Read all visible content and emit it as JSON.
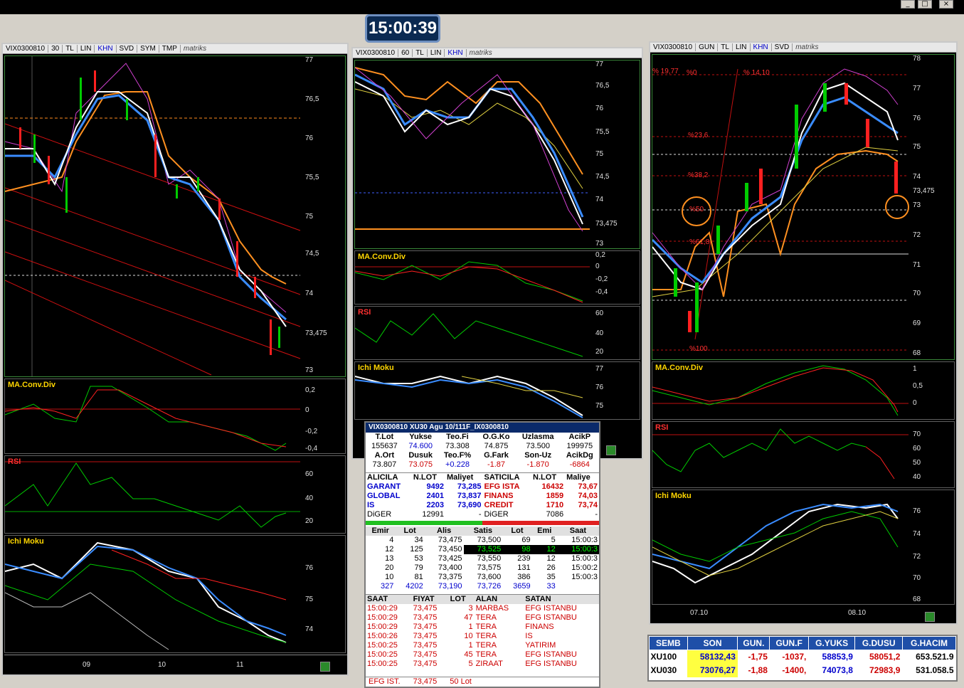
{
  "clock": "15:00:39",
  "window_controls": [
    "_",
    "□",
    "×"
  ],
  "panels": {
    "left": {
      "symbol": "VIX0300810",
      "period": "30",
      "tabs": [
        "TL",
        "LIN",
        "KHN",
        "SVD",
        "SYM",
        "TMP"
      ],
      "brand": "matriks",
      "price_ticks": [
        "77",
        "76,5",
        "76",
        "75,5",
        "75",
        "74,5",
        "74",
        "73,475",
        "73"
      ],
      "sub_labels": [
        "MA.Conv.Div",
        "RSI",
        "Ichi Moku"
      ],
      "macd_ticks": [
        "0,2",
        "0",
        "-0,2",
        "-0,4"
      ],
      "rsi_ticks": [
        "60",
        "40",
        "20"
      ],
      "ichi_ticks": [
        "76",
        "75",
        "74"
      ],
      "x_ticks": [
        "09",
        "10",
        "11"
      ]
    },
    "middle": {
      "symbol": "VIX0300810",
      "period": "60",
      "tabs": [
        "TL",
        "LIN",
        "KHN"
      ],
      "brand": "matriks",
      "price_ticks": [
        "77",
        "76,5",
        "76",
        "75,5",
        "75",
        "74,5",
        "74",
        "73,475",
        "73"
      ],
      "sub_labels": [
        "MA.Conv.Div",
        "RSI",
        "Ichi Moku"
      ],
      "macd_ticks": [
        "0,2",
        "0",
        "-0,2",
        "-0,4"
      ],
      "rsi_ticks": [
        "60",
        "40",
        "20"
      ],
      "ichi_ticks": [
        "77",
        "76",
        "75"
      ]
    },
    "right": {
      "symbol": "VIX0300810",
      "period": "GUN",
      "tabs": [
        "TL",
        "LIN",
        "KHN",
        "SVD"
      ],
      "brand": "matriks",
      "price_ticks": [
        "78",
        "77",
        "76",
        "75",
        "74",
        "73,475",
        "73",
        "72",
        "71",
        "70",
        "69",
        "68"
      ],
      "fib_labels": [
        "% 19,77",
        "%0",
        "% 14,10",
        "%23,6",
        "%38,2",
        "%50",
        "%61,8",
        "%100"
      ],
      "sub_labels": [
        "MA.Conv.Div",
        "RSI",
        "Ichi Moku"
      ],
      "macd_ticks": [
        "1",
        "0,5",
        "0"
      ],
      "rsi_ticks": [
        "70",
        "60",
        "50",
        "40"
      ],
      "ichi_ticks": [
        "76",
        "74",
        "72",
        "70",
        "68"
      ],
      "x_ticks": [
        "07.10",
        "08.10"
      ]
    }
  },
  "ticker": {
    "title": "VIX0300810   XU30 Agu 10/111F_IX0300810",
    "summary_headers1": [
      "T.Lot",
      "Yukse",
      "Teo.Fi",
      "O.G.Ko",
      "Uzlasma",
      "AcikP"
    ],
    "summary_values1": [
      "155637",
      "74.600",
      "73.308",
      "74.875",
      "73.500",
      "199975"
    ],
    "summary_headers2": [
      "A.Ort",
      "Dusuk",
      "Teo.F%",
      "G.Fark",
      "Son-Uz",
      "AcikDg"
    ],
    "summary_values2": [
      "73.807",
      "73.075",
      "+0.228",
      "-1.87",
      "-1.870",
      "-6864"
    ],
    "broker_headers": [
      "ALICILA",
      "N.LOT",
      "Maliyet",
      "SATICILA",
      "N.LOT",
      "Maliye"
    ],
    "brokers": [
      [
        "GARANT",
        "9492",
        "73,285",
        "EFG ISTA",
        "16432",
        "73,67"
      ],
      [
        "GLOBAL",
        "2401",
        "73,837",
        "FINANS",
        "1859",
        "74,03"
      ],
      [
        "IS",
        "2203",
        "73,690",
        "CREDIT",
        "1710",
        "73,74"
      ],
      [
        "DiGER",
        "12991",
        "-",
        "DiGER",
        "7086",
        "-"
      ]
    ],
    "depth_headers": [
      "Emir",
      "Lot",
      "Alis",
      "Satis",
      "Lot",
      "Emi",
      "Saat"
    ],
    "depth": [
      [
        "4",
        "34",
        "73,475",
        "73,500",
        "69",
        "5",
        "15:00:3"
      ],
      [
        "12",
        "125",
        "73,450",
        "73,525",
        "98",
        "12",
        "15:00:3"
      ],
      [
        "13",
        "53",
        "73,425",
        "73,550",
        "239",
        "12",
        "15:00:3"
      ],
      [
        "20",
        "79",
        "73,400",
        "73,575",
        "131",
        "26",
        "15:00:2"
      ],
      [
        "10",
        "81",
        "73,375",
        "73,600",
        "386",
        "35",
        "15:00:3"
      ]
    ],
    "depth_total": [
      "327",
      "4202",
      "73,190",
      "73,726",
      "3659",
      "33",
      ""
    ],
    "trade_headers": [
      "SAAT",
      "FIYAT",
      "LOT",
      "ALAN",
      "SATAN"
    ],
    "trades": [
      [
        "15:00:29",
        "73,475",
        "3",
        "MARBAS",
        "EFG ISTANBU"
      ],
      [
        "15:00:29",
        "73,475",
        "47",
        "TERA",
        "EFG ISTANBU"
      ],
      [
        "15:00:29",
        "73,475",
        "1",
        "TERA",
        "FINANS"
      ],
      [
        "15:00:26",
        "73,475",
        "10",
        "TERA",
        "IS"
      ],
      [
        "15:00:25",
        "73,475",
        "1",
        "TERA",
        "YATIRIM"
      ],
      [
        "15:00:25",
        "73,475",
        "45",
        "TERA",
        "EFG ISTANBU"
      ],
      [
        "15:00:25",
        "73,475",
        "5",
        "ZIRAAT",
        "EFG ISTANBU"
      ]
    ],
    "footer": [
      "EFG IST.",
      "73,475",
      "50 Lot"
    ]
  },
  "quotes": {
    "headers": [
      "SEMB",
      "SON",
      "GUN.",
      "GUN.F",
      "G.YUKS",
      "G.DUSU",
      "G.HACIM"
    ],
    "rows": [
      [
        "XU100",
        "58132,43",
        "-1,75",
        "-1037,",
        "58853,9",
        "58051,2",
        "653.521.9"
      ],
      [
        "XU030",
        "73076,27",
        "-1,88",
        "-1400,",
        "74073,8",
        "72983,9",
        "531.058.5"
      ]
    ]
  },
  "colors": {
    "bull": "#00cc00",
    "bear": "#ff2020",
    "ma_white": "#ffffff",
    "ma_blue": "#3a8cff",
    "ma_orange": "#ff9020",
    "ma_magenta": "#d040d0"
  }
}
